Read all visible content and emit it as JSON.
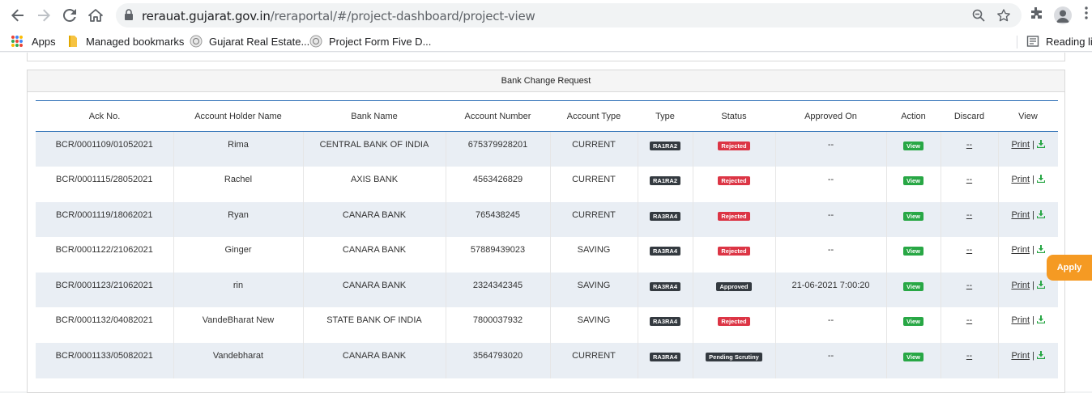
{
  "browser": {
    "url_domain": "rerauat.gujarat.gov.in",
    "url_path": "/reraportal/#/project-dashboard/project-view",
    "bookmarks": {
      "apps": "Apps",
      "managed": "Managed bookmarks",
      "gujarat": "Gujarat Real Estate...",
      "project_form": "Project Form Five D...",
      "reading_list": "Reading lis"
    }
  },
  "panel": {
    "title": "Bank Change Request"
  },
  "table": {
    "headers": [
      "Ack No.",
      "Account Holder Name",
      "Bank Name",
      "Account Number",
      "Account Type",
      "Type",
      "Status",
      "Approved On",
      "Action",
      "Discard",
      "View"
    ],
    "rows": [
      {
        "ack": "BCR/0001109/01052021",
        "holder": "Rima",
        "bank": "CENTRAL BANK OF INDIA",
        "account": "675379928201",
        "acc_type": "CURRENT",
        "type": "RA1RA2",
        "status": "Rejected",
        "approved_on": "--",
        "action": "View",
        "discard": "--",
        "print": "Print",
        "sep": "|"
      },
      {
        "ack": "BCR/0001115/28052021",
        "holder": "Rachel",
        "bank": "AXIS BANK",
        "account": "4563426829",
        "acc_type": "CURRENT",
        "type": "RA1RA2",
        "status": "Rejected",
        "approved_on": "--",
        "action": "View",
        "discard": "--",
        "print": "Print",
        "sep": "|"
      },
      {
        "ack": "BCR/0001119/18062021",
        "holder": "Ryan",
        "bank": "CANARA BANK",
        "account": "765438245",
        "acc_type": "CURRENT",
        "type": "RA3RA4",
        "status": "Rejected",
        "approved_on": "--",
        "action": "View",
        "discard": "--",
        "print": "Print",
        "sep": "|"
      },
      {
        "ack": "BCR/0001122/21062021",
        "holder": "Ginger",
        "bank": "CANARA BANK",
        "account": "57889439023",
        "acc_type": "SAVING",
        "type": "RA3RA4",
        "status": "Rejected",
        "approved_on": "--",
        "action": "View",
        "discard": "--",
        "print": "Print",
        "sep": "|"
      },
      {
        "ack": "BCR/0001123/21062021",
        "holder": "rin",
        "bank": "CANARA BANK",
        "account": "2324342345",
        "acc_type": "SAVING",
        "type": "RA3RA4",
        "status": "Approved",
        "approved_on": "21-06-2021 7:00:20",
        "action": "View",
        "discard": "--",
        "print": "Print",
        "sep": "|"
      },
      {
        "ack": "BCR/0001132/04082021",
        "holder": "VandeBharat New",
        "bank": "STATE BANK OF INDIA",
        "account": "7800037932",
        "acc_type": "SAVING",
        "type": "RA3RA4",
        "status": "Rejected",
        "approved_on": "--",
        "action": "View",
        "discard": "--",
        "print": "Print",
        "sep": "|"
      },
      {
        "ack": "BCR/0001133/05082021",
        "holder": "Vandebharat",
        "bank": "CANARA BANK",
        "account": "3564793020",
        "acc_type": "CURRENT",
        "type": "RA3RA4",
        "status": "Pending Scrutiny",
        "approved_on": "--",
        "action": "View",
        "discard": "--",
        "print": "Print",
        "sep": "|"
      }
    ]
  },
  "apply_button": "Apply",
  "colors": {
    "rejected": "#dc3545",
    "view": "#28a745",
    "dark_badge": "#343a40",
    "apply": "#f59a23",
    "table_border": "#2c6fb6",
    "row_alt": "#e9eef4"
  }
}
